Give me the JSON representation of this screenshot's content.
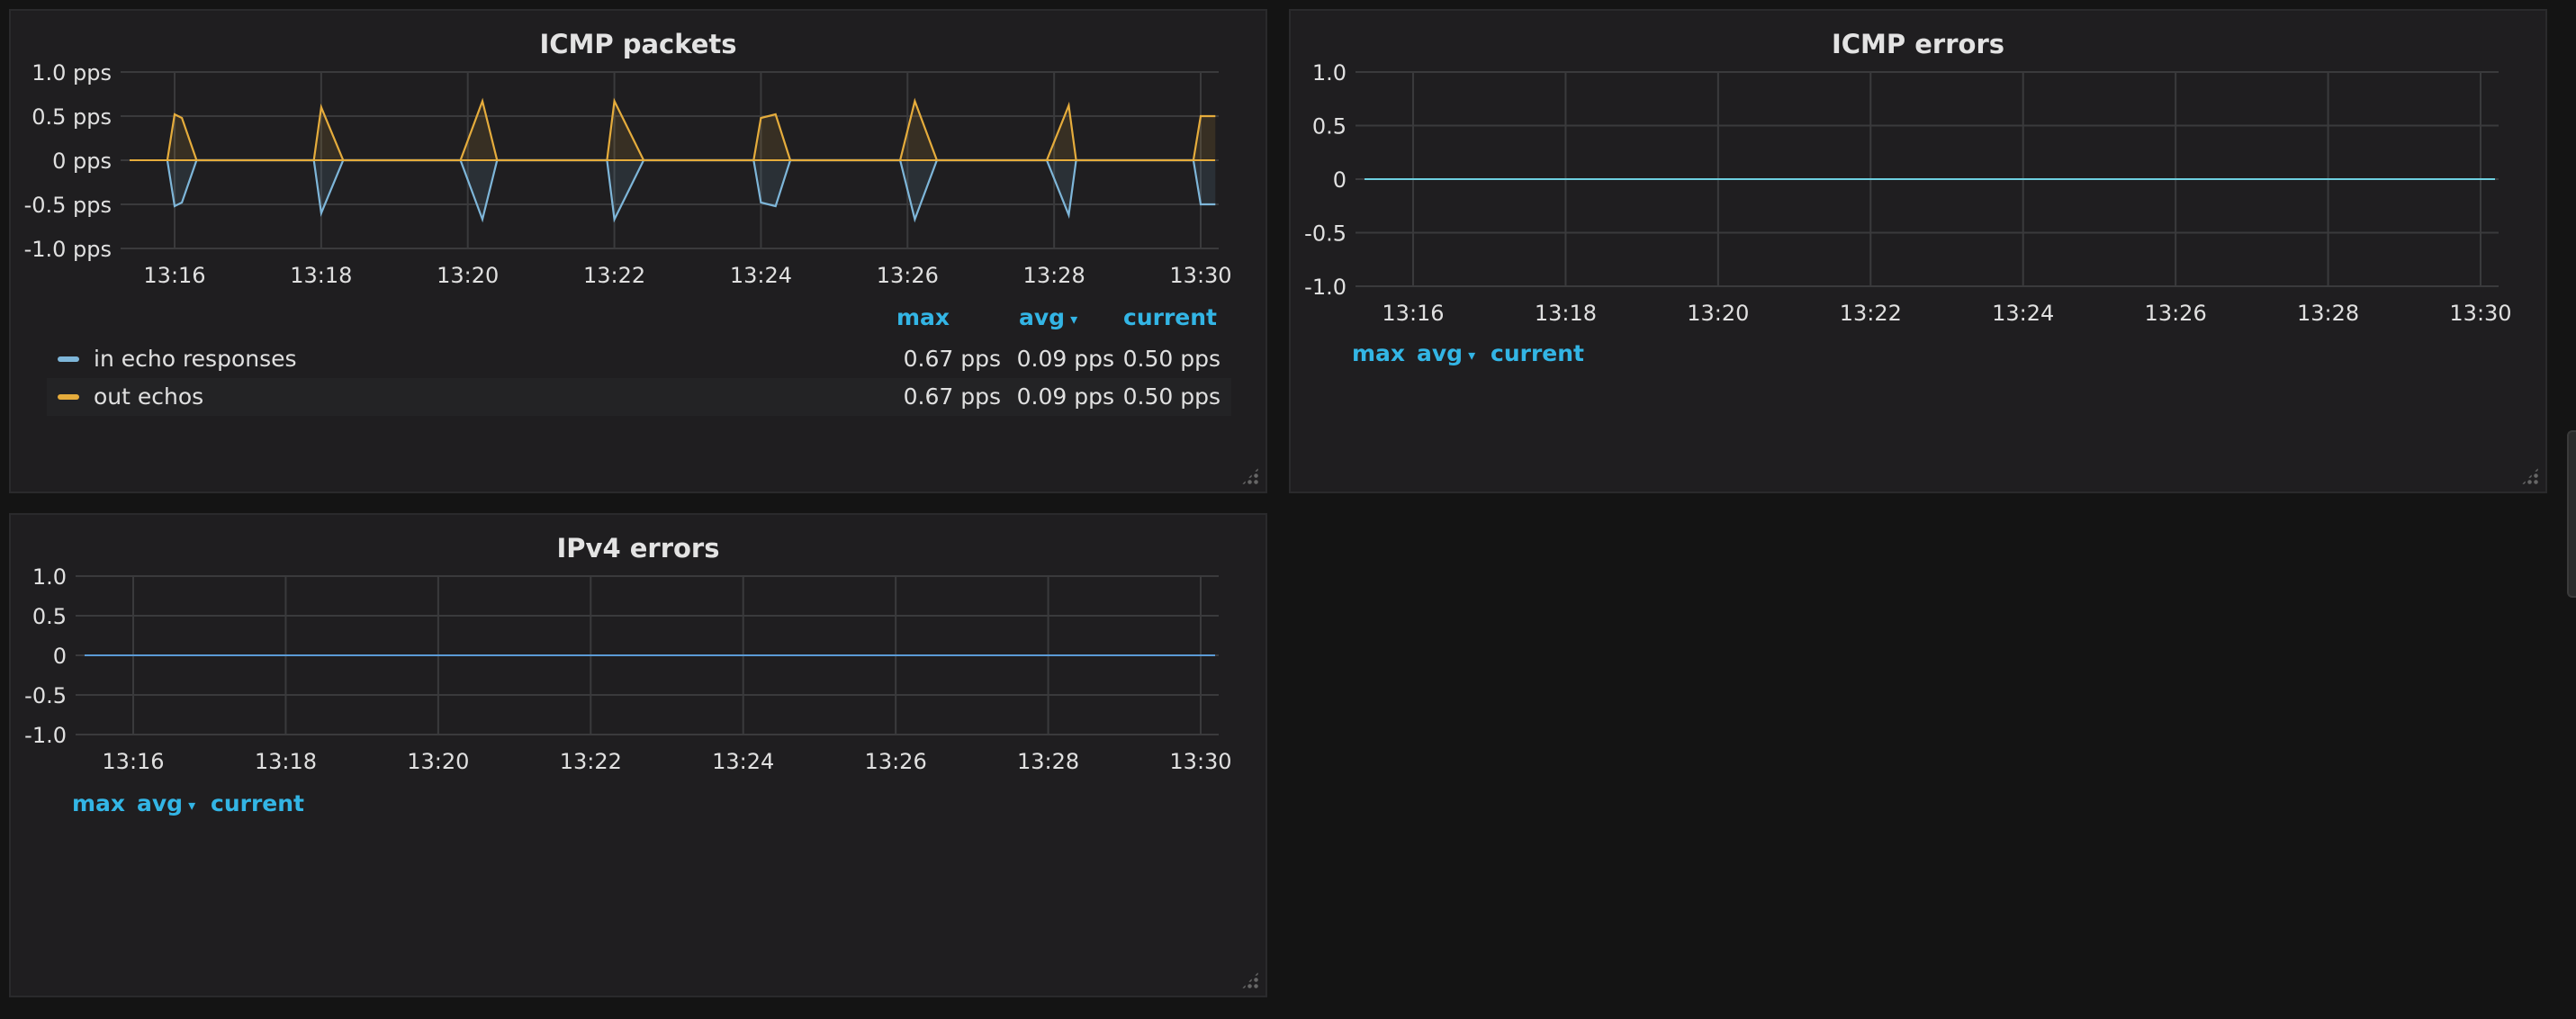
{
  "colors": {
    "in_series": "#7eb6d9",
    "out_series": "#e5ac3c",
    "legend_header": "#33b5e5",
    "grid": "#3a3a3c",
    "flat_line_icmp": "#6ed0e0",
    "flat_line_ipv4": "#5b9bd5"
  },
  "panels": {
    "icmp_packets": {
      "title": "ICMP packets",
      "legend": {
        "headers": {
          "max": "max",
          "avg": "avg",
          "current": "current"
        },
        "rows": [
          {
            "name": "in echo responses",
            "max": "0.67 pps",
            "avg": "0.09 pps",
            "current": "0.50 pps"
          },
          {
            "name": "out echos",
            "max": "0.67 pps",
            "avg": "0.09 pps",
            "current": "0.50 pps"
          }
        ]
      }
    },
    "icmp_errors": {
      "title": "ICMP errors",
      "legend": {
        "headers": {
          "max": "max",
          "avg": "avg",
          "current": "current"
        }
      }
    },
    "ipv4_errors": {
      "title": "IPv4 errors",
      "legend": {
        "headers": {
          "max": "max",
          "avg": "avg",
          "current": "current"
        }
      }
    }
  },
  "chart_data": [
    {
      "type": "line",
      "title": "ICMP packets",
      "x": [
        "13:16",
        "13:18",
        "13:20",
        "13:22",
        "13:24",
        "13:26",
        "13:28",
        "13:30"
      ],
      "y_ticks": [
        "1.0 pps",
        "0.5 pps",
        "0 pps",
        "-0.5 pps",
        "-1.0 pps"
      ],
      "ylim": [
        -1.0,
        1.0
      ],
      "grid": true,
      "series": [
        {
          "name": "out echos",
          "points": [
            [
              "13:15.9",
              0
            ],
            [
              "13:16.0",
              0.52
            ],
            [
              "13:16.1",
              0.48
            ],
            [
              "13:16.3",
              0
            ],
            [
              "13:17.9",
              0
            ],
            [
              "13:18.0",
              0.6
            ],
            [
              "13:18.1",
              0.4
            ],
            [
              "13:18.3",
              0
            ],
            [
              "13:19.9",
              0
            ],
            [
              "13:20.2",
              0.67
            ],
            [
              "13:20.4",
              0
            ],
            [
              "13:21.9",
              0
            ],
            [
              "13:22.0",
              0.67
            ],
            [
              "13:22.4",
              0
            ],
            [
              "13:23.9",
              0
            ],
            [
              "13:24.0",
              0.48
            ],
            [
              "13:24.2",
              0.52
            ],
            [
              "13:24.4",
              0
            ],
            [
              "13:25.9",
              0
            ],
            [
              "13:26.1",
              0.67
            ],
            [
              "13:26.4",
              0
            ],
            [
              "13:27.9",
              0
            ],
            [
              "13:28.2",
              0.62
            ],
            [
              "13:28.3",
              0
            ],
            [
              "13:29.9",
              0
            ],
            [
              "13:30.0",
              0.5
            ],
            [
              "13:30.2",
              0.5
            ]
          ]
        },
        {
          "name": "in echo responses",
          "points": [
            [
              "13:15.9",
              0
            ],
            [
              "13:16.0",
              -0.52
            ],
            [
              "13:16.1",
              -0.48
            ],
            [
              "13:16.3",
              0
            ],
            [
              "13:17.9",
              0
            ],
            [
              "13:18.0",
              -0.6
            ],
            [
              "13:18.1",
              -0.4
            ],
            [
              "13:18.3",
              0
            ],
            [
              "13:19.9",
              0
            ],
            [
              "13:20.2",
              -0.67
            ],
            [
              "13:20.4",
              0
            ],
            [
              "13:21.9",
              0
            ],
            [
              "13:22.0",
              -0.67
            ],
            [
              "13:22.4",
              0
            ],
            [
              "13:23.9",
              0
            ],
            [
              "13:24.0",
              -0.48
            ],
            [
              "13:24.2",
              -0.52
            ],
            [
              "13:24.4",
              0
            ],
            [
              "13:25.9",
              0
            ],
            [
              "13:26.1",
              -0.67
            ],
            [
              "13:26.4",
              0
            ],
            [
              "13:27.9",
              0
            ],
            [
              "13:28.2",
              -0.62
            ],
            [
              "13:28.3",
              0
            ],
            [
              "13:29.9",
              0
            ],
            [
              "13:30.0",
              -0.5
            ],
            [
              "13:30.2",
              -0.5
            ]
          ]
        }
      ]
    },
    {
      "type": "line",
      "title": "ICMP errors",
      "x": [
        "13:16",
        "13:18",
        "13:20",
        "13:22",
        "13:24",
        "13:26",
        "13:28",
        "13:30"
      ],
      "y_ticks": [
        "1.0",
        "0.5",
        "0",
        "-0.5",
        "-1.0"
      ],
      "ylim": [
        -1.0,
        1.0
      ],
      "grid": true,
      "series": [
        {
          "values": [
            0,
            0,
            0,
            0,
            0,
            0,
            0,
            0
          ]
        }
      ]
    },
    {
      "type": "line",
      "title": "IPv4 errors",
      "x": [
        "13:16",
        "13:18",
        "13:20",
        "13:22",
        "13:24",
        "13:26",
        "13:28",
        "13:30"
      ],
      "y_ticks": [
        "1.0",
        "0.5",
        "0",
        "-0.5",
        "-1.0"
      ],
      "ylim": [
        -1.0,
        1.0
      ],
      "grid": true,
      "series": [
        {
          "values": [
            0,
            0,
            0,
            0,
            0,
            0,
            0,
            0
          ]
        }
      ]
    }
  ]
}
